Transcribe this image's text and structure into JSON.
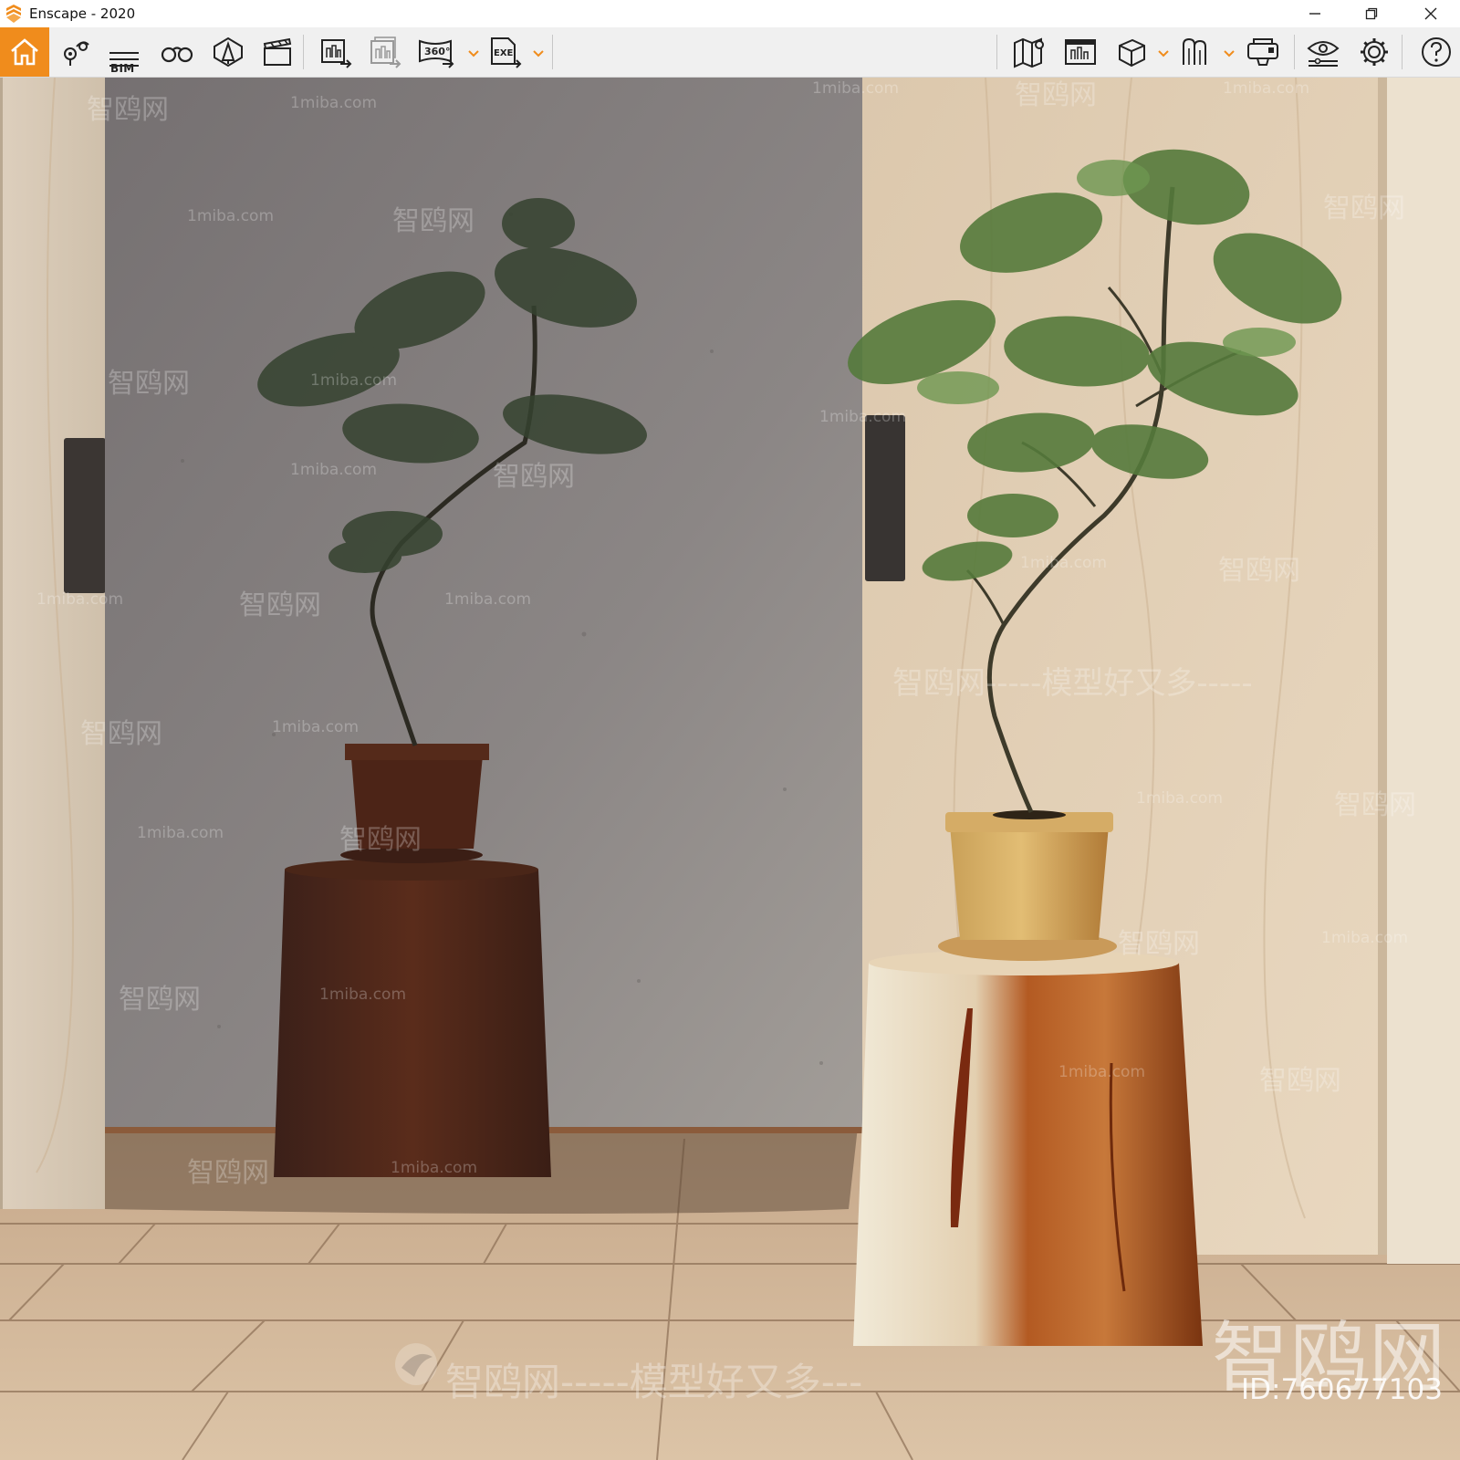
{
  "window": {
    "title": "Enscape - 2020",
    "icons": [
      "enscape-logo-icon",
      "minimize-icon",
      "restore-icon",
      "close-icon"
    ]
  },
  "toolbar": {
    "bim_label": "BIM",
    "accent_color": "#f08c1c",
    "left_buttons": [
      "home-icon",
      "views-icon",
      "bim-icon",
      "binoculars-icon",
      "asset-library-icon",
      "video-editor-icon"
    ],
    "export_buttons": [
      "render-export-icon",
      "batch-render-icon",
      "panorama-360-icon",
      "exe-export-icon"
    ],
    "right_buttons": [
      "map-icon",
      "info-panel-icon",
      "cube-icon",
      "bookmarks-icon",
      "vr-headset-icon",
      "visual-settings-icon",
      "settings-icon",
      "help-icon"
    ],
    "panorama_label": "360°",
    "exe_label": "EXE"
  },
  "watermarks": {
    "site": "1miba.com",
    "brand": "智鸥网",
    "dashes": "------",
    "slogan": "智鸥网-----模型好又多-----",
    "slogan_mid": "智鸥网-----模型好又多---",
    "brand_big": "智鸥网",
    "id_text": "ID:760677103"
  }
}
